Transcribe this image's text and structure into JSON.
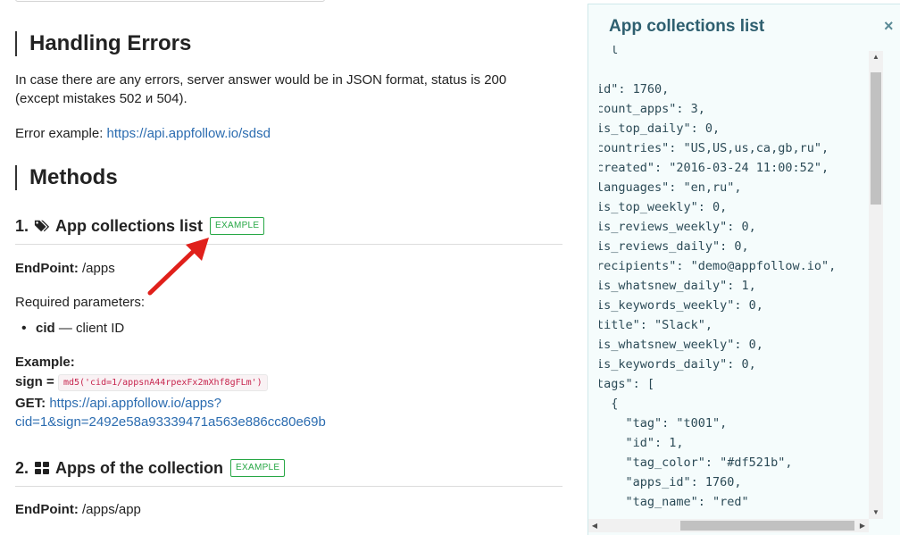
{
  "doc": {
    "handling_errors": {
      "heading": "Handling Errors",
      "text_line1": "In case there are any errors, server answer would be in JSON format, status is 200",
      "text_line2": "(except mistakes 502 и 504).",
      "error_example_label": "Error example:",
      "error_example_link": "https://api.appfollow.io/sdsd"
    },
    "methods_heading": "Methods",
    "method1": {
      "number": "1.",
      "icon": "tags-icon",
      "title": "App collections list",
      "badge": "EXAMPLE",
      "endpoint_label": "EndPoint:",
      "endpoint_value": "/apps",
      "required_label": "Required parameters:",
      "params": [
        {
          "name": "cid",
          "desc": "— client ID"
        }
      ],
      "example_label": "Example:",
      "sign_label": "sign =",
      "sign_value": "md5('cid=1/appsnA44rpexFx2mXhf8gFLm')",
      "get_label": "GET:",
      "get_link_line1": "https://api.appfollow.io/apps?",
      "get_link_line2": "cid=1&sign=2492e58a93339471a563e886cc80e69b"
    },
    "method2": {
      "number": "2.",
      "icon": "th-large-icon",
      "title": "Apps of the collection",
      "badge": "EXAMPLE",
      "endpoint_label": "EndPoint:",
      "endpoint_value": "/apps/app"
    }
  },
  "panel": {
    "title": "App collections list",
    "close": "×",
    "code_lines": [
      "  l",
      "",
      "id\": 1760,",
      "count_apps\": 3,",
      "is_top_daily\": 0,",
      "countries\": \"US,US,us,ca,gb,ru\",",
      "created\": \"2016-03-24 11:00:52\",",
      "languages\": \"en,ru\",",
      "is_top_weekly\": 0,",
      "is_reviews_weekly\": 0,",
      "is_reviews_daily\": 0,",
      "recipients\": \"demo@appfollow.io\",",
      "is_whatsnew_daily\": 1,",
      "is_keywords_weekly\": 0,",
      "title\": \"Slack\",",
      "is_whatsnew_weekly\": 0,",
      "is_keywords_daily\": 0,",
      "tags\": [",
      "  {",
      "    \"tag\": \"t001\",",
      "    \"id\": 1,",
      "    \"tag_color\": \"#df521b\",",
      "    \"apps_id\": 1760,",
      "    \"tag_name\": \"red\"",
      "  },"
    ]
  },
  "colors": {
    "link": "#2b6cb0",
    "badge": "#27a745",
    "arrow": "#e0201b",
    "panel_bg": "#f5fcfc",
    "panel_title": "#2e5f6f"
  }
}
